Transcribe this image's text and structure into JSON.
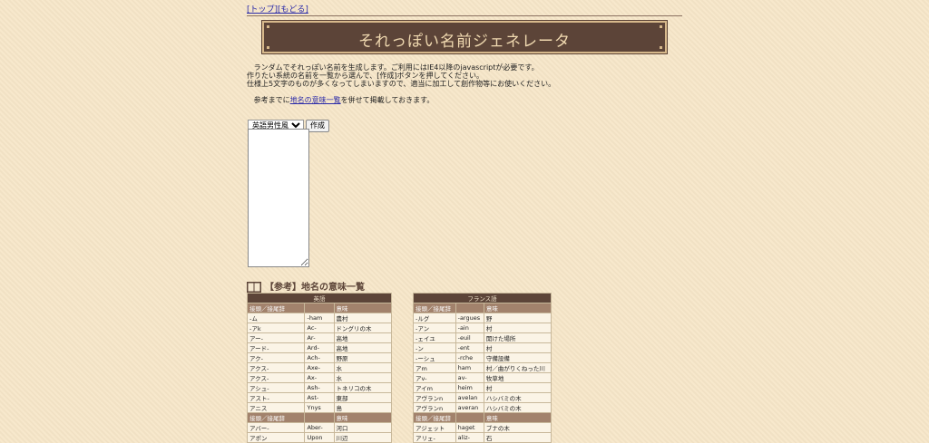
{
  "nav": {
    "top": "[トップ]",
    "back": "[もどる]"
  },
  "banner": {
    "title": "それっぽい名前ジェネレータ"
  },
  "desc": {
    "line1": "ランダムでそれっぽい名前を生成します。ご利用にはIE4以降のjavascriptが必要です。",
    "line2": "作りたい系統の名前を一覧から選んで、[作成]ボタンを押してください。",
    "line3": "仕様上5文字のものが多くなってしまいますので、適当に加工して創作物等にお使いください。",
    "line4_pre": "参考までに",
    "line4_link": "地名の意味一覧",
    "line4_post": "を併せて掲載しておきます。"
  },
  "form": {
    "select_value": "英語男性風",
    "button": "作成"
  },
  "reference": {
    "title": "【参考】地名の意味一覧"
  },
  "tables": [
    {
      "title": "英語",
      "header": [
        "接頭／接尾辞",
        "",
        "意味"
      ],
      "rows": [
        [
          "-ム",
          "-ham",
          "農村"
        ],
        [
          "-アk",
          "Ac-",
          "ドングリの木"
        ],
        [
          "アー-",
          "Ar-",
          "高地"
        ],
        [
          "アード-",
          "Ard-",
          "高地"
        ],
        [
          "アク-",
          "Ach-",
          "野原"
        ],
        [
          "アクス-",
          "Axe-",
          "水"
        ],
        [
          "アクス-",
          "Ax-",
          "水"
        ],
        [
          "アシュ-",
          "Ash-",
          "トネリコの木"
        ],
        [
          "アスト-",
          "Ast-",
          "東部"
        ],
        [
          "アニス",
          "Ynys",
          "島"
        ]
      ],
      "header2": [
        "接頭／接尾辞",
        "",
        "意味"
      ],
      "rows2": [
        [
          "アバー-",
          "Aber-",
          "河口"
        ],
        [
          "アポン",
          "Upon",
          "川辺"
        ]
      ]
    },
    {
      "title": "フランス語",
      "header": [
        "接頭／接尾辞",
        "",
        "意味"
      ],
      "rows": [
        [
          "-ルグ",
          "-argues",
          "野"
        ],
        [
          "-アン",
          "-ain",
          "村"
        ],
        [
          "-ェイユ",
          "-euil",
          "開けた場所"
        ],
        [
          "-ン",
          "-ent",
          "村"
        ],
        [
          "-ーシュ",
          "-rche",
          "守備設備"
        ],
        [
          "アm",
          "ham",
          "村／曲がりくねった川"
        ],
        [
          "アv-",
          "av-",
          "牧草地"
        ],
        [
          "アイm",
          "heim",
          "村"
        ],
        [
          "アヴランn",
          "avelan",
          "ハシバミの木"
        ],
        [
          "アヴランn",
          "averan",
          "ハシバミの木"
        ]
      ],
      "header2": [
        "接頭／接尾辞",
        "",
        "意味"
      ],
      "rows2": [
        [
          "アジェット",
          "haget",
          "ブナの木"
        ],
        [
          "アリェ-",
          "aliz-",
          "石"
        ]
      ]
    }
  ]
}
